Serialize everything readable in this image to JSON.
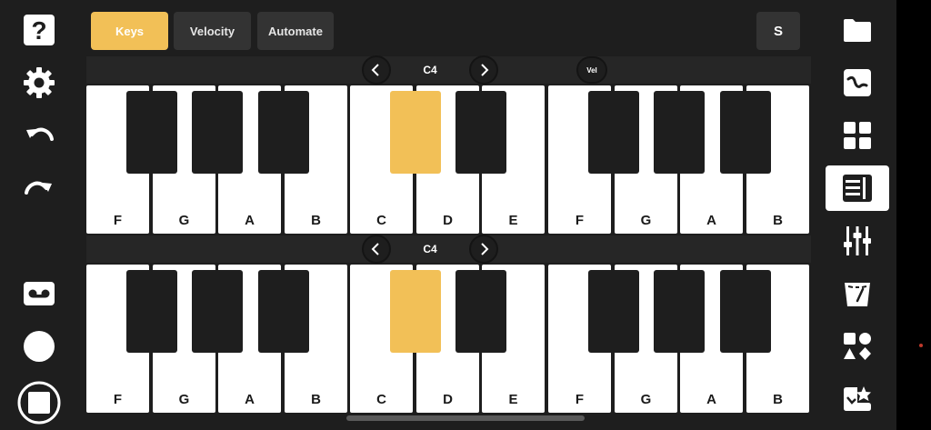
{
  "tabs": [
    {
      "label": "Keys",
      "active": true
    },
    {
      "label": "Velocity",
      "active": false
    },
    {
      "label": "Automate",
      "active": false
    }
  ],
  "solo_label": "S",
  "velocity_label": "Vel",
  "keyboards": [
    {
      "octave": "C4",
      "white_keys": [
        "F",
        "G",
        "A",
        "B",
        "C",
        "D",
        "E",
        "F",
        "G",
        "A",
        "B"
      ],
      "active_black_key": "C#"
    },
    {
      "octave": "C4",
      "white_keys": [
        "F",
        "G",
        "A",
        "B",
        "C",
        "D",
        "E",
        "F",
        "G",
        "A",
        "B"
      ],
      "active_black_key": "C#"
    }
  ],
  "left_toolbar": [
    "help-icon",
    "settings-icon",
    "undo-icon",
    "redo-icon",
    "tape-icon",
    "record-icon",
    "stop-icon"
  ],
  "right_sidebar": [
    "folder-icon",
    "waveform-icon",
    "grid-icon",
    "piano-roll-icon",
    "mixer-icon",
    "tuner-icon",
    "shapes-icon",
    "effects-icon"
  ],
  "colors": {
    "accent": "#f2c057",
    "background": "#1e1e1e",
    "panel": "#333333"
  }
}
